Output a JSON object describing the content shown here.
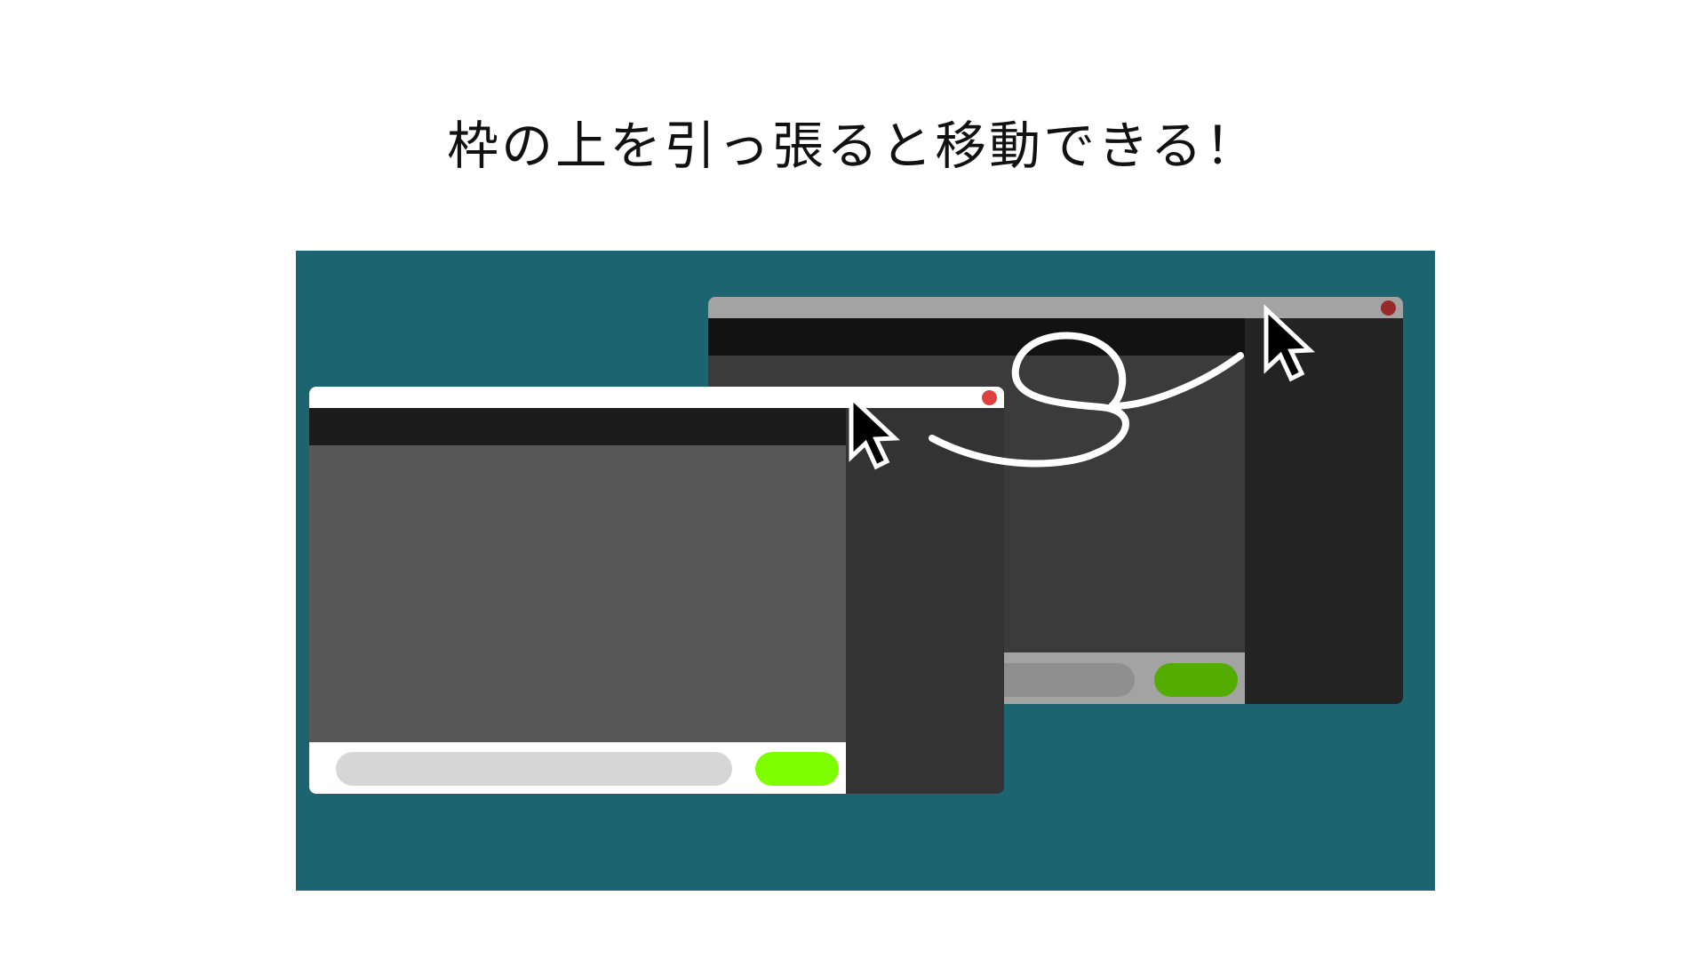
{
  "caption": "枠の上を引っ張ると移動できる！",
  "colors": {
    "page_bg": "#ffffff",
    "panel_bg": "#1c6470",
    "front": {
      "titlebar": "#ffffff",
      "close": "#e04040",
      "toolbar": "#1c1c1c",
      "content": "#585858",
      "sidebar": "#333333",
      "footer": "#ffffff",
      "field": "#d6d6d6",
      "button": "#7dff00"
    },
    "back": {
      "titlebar": "#a3a3a3",
      "close": "#9a2a2a",
      "toolbar": "#121212",
      "content": "#3b3b3b",
      "sidebar": "#232323",
      "footer": "#a3a3a3",
      "field": "#8f8f8f",
      "button": "#54ac00"
    },
    "cursor_fill": "#000000",
    "cursor_outline": "#ffffff",
    "path_stroke": "#ffffff"
  },
  "icons": {
    "cursor": "mouse-pointer-arrow",
    "close": "close-dot"
  }
}
